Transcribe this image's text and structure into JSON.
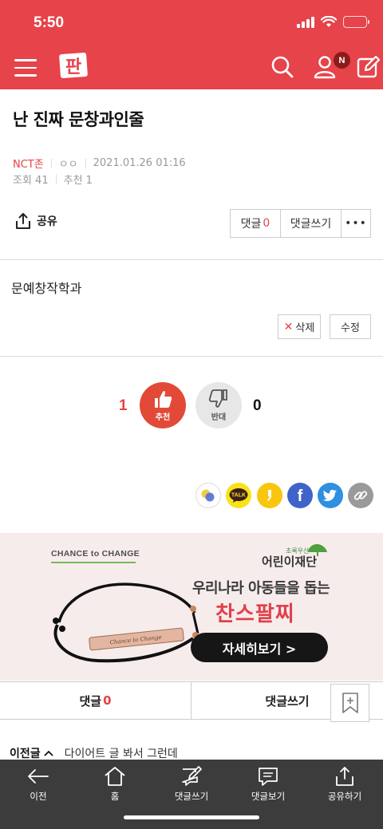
{
  "status": {
    "time": "5:50"
  },
  "header": {
    "logo_text": "판",
    "notification_badge": "N"
  },
  "post": {
    "title": "난 진짜 문창과인줄",
    "board": "NCT존",
    "author": "ㅇㅇ",
    "datetime": "2021.01.26 01:16",
    "views": "조회 41",
    "recommends": "추천 1",
    "body": "문예창작학과"
  },
  "actions": {
    "share": "공유",
    "comment_label": "댓글",
    "comment_count": "0",
    "write_comment": "댓글쓰기",
    "more": "•••",
    "delete": "삭제",
    "delete_mark": "✕",
    "edit": "수정"
  },
  "vote": {
    "up_count": "1",
    "up_label": "추천",
    "down_label": "반대",
    "down_count": "0"
  },
  "social": {
    "icons": [
      "naver-band-icon",
      "kakaotalk-icon",
      "kakaostory-icon",
      "facebook-icon",
      "twitter-icon",
      "link-icon"
    ],
    "talk_text": "TALK",
    "facebook_glyph": "f"
  },
  "banner": {
    "brand": "CHANCE to CHANGE",
    "org_small": "초록우산",
    "org_name": "어린이재단",
    "headline": "우리나라 아동들을 돕는",
    "product": "찬스팔찌",
    "cta": "자세히보기 >",
    "engraving": "Chance to Change"
  },
  "comment_bar": {
    "comments_label": "댓글",
    "comments_count": "0",
    "write_label": "댓글쓰기"
  },
  "prev_post": {
    "label": "이전글",
    "title": "다이어트 글 봐서 그런데"
  },
  "toolbar": {
    "items": [
      {
        "label": "이전"
      },
      {
        "label": "홈"
      },
      {
        "label": "댓글쓰기"
      },
      {
        "label": "댓글보기"
      },
      {
        "label": "공유하기"
      }
    ]
  },
  "colors": {
    "brand_red": "#e6434a",
    "toolbar_bg": "#3c3c3c",
    "banner_bg": "#f7ecec"
  }
}
